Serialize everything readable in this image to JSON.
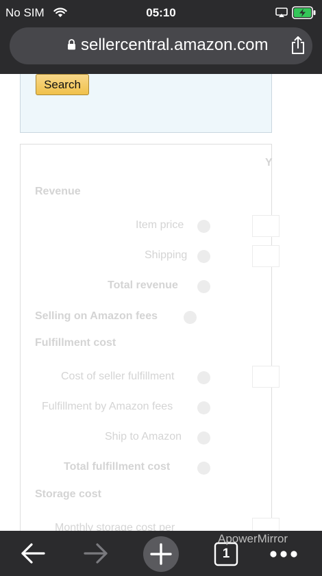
{
  "status_bar": {
    "carrier": "No SIM",
    "time": "05:10",
    "icons": [
      "wifi-icon",
      "airplay-icon",
      "battery-charging-icon"
    ]
  },
  "browser": {
    "url": "sellercentral.amazon.com",
    "icons": [
      "lock-icon",
      "share-icon"
    ]
  },
  "search": {
    "button_label": "Search"
  },
  "calculator": {
    "column_header": "Y",
    "sections": [
      {
        "label": "Revenue"
      },
      {
        "label": "Item price"
      },
      {
        "label": "Shipping"
      },
      {
        "label": "Total revenue"
      },
      {
        "label": "Selling on Amazon fees"
      },
      {
        "label": "Fulfillment cost"
      },
      {
        "label": "Cost of seller fulfillment"
      },
      {
        "label": "Fulfillment by Amazon fees"
      },
      {
        "label": "Ship to Amazon"
      },
      {
        "label": "Total fulfillment cost"
      },
      {
        "label": "Storage cost"
      },
      {
        "label": "Monthly storage cost per"
      }
    ]
  },
  "toolbar": {
    "icons": [
      "back-arrow-icon",
      "forward-arrow-icon",
      "new-tab-plus-icon",
      "tabs-count-icon",
      "more-dots-icon"
    ],
    "tab_count": "1"
  },
  "watermark": "ApowerMirror"
}
